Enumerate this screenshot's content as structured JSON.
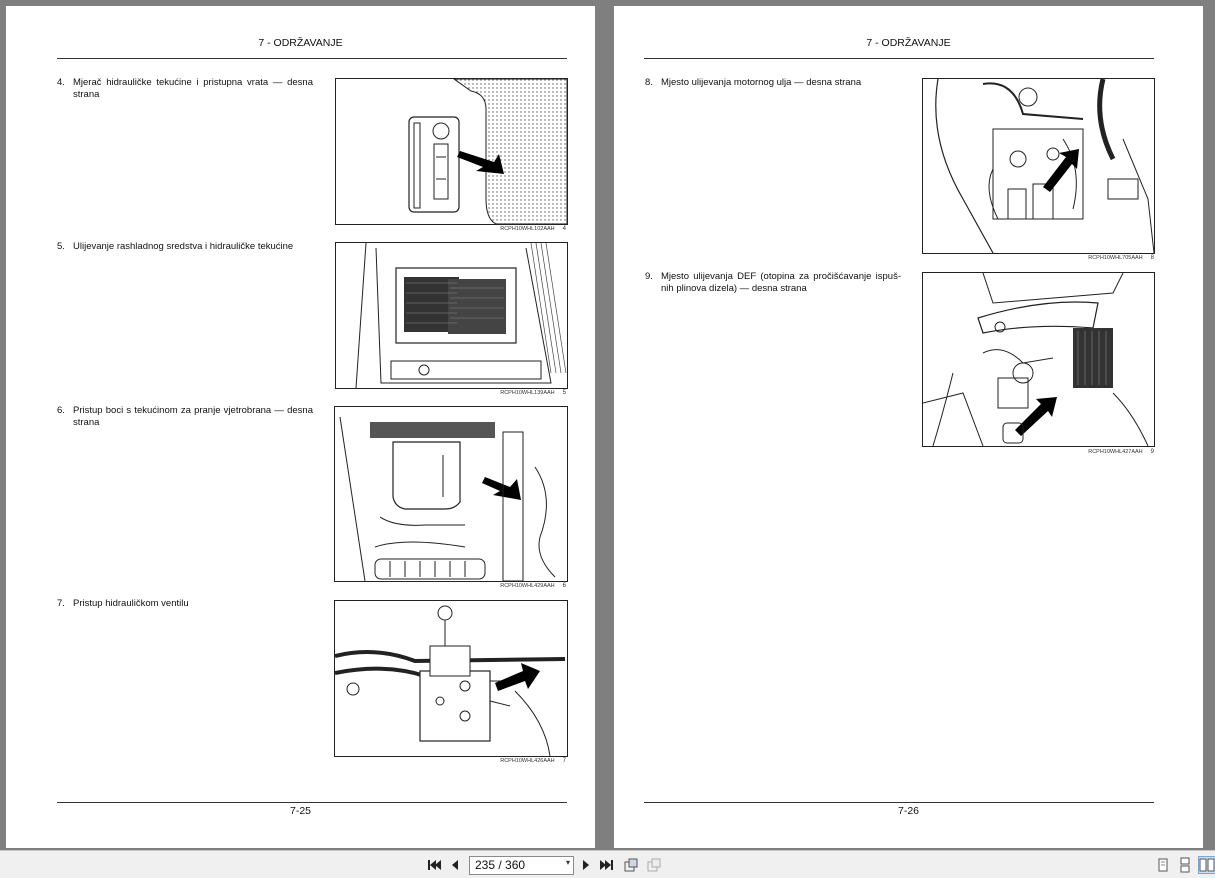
{
  "left_page": {
    "header": "7 - ODRŽAVANJE",
    "footer": "7-25",
    "items": [
      {
        "num": "4.",
        "text": "Mjerač hidrauličke tekućine i pristupna vrata — desna strana",
        "caption": "RCPH10WHL102AAH",
        "fig": "4"
      },
      {
        "num": "5.",
        "text": "Ulijevanje rashladnog sredstva i hidrauličke tekućine",
        "caption": "RCPH10WHL139AAH",
        "fig": "5"
      },
      {
        "num": "6.",
        "text": "Pristup boci s tekućinom za pranje vjetrobrana — desna strana",
        "caption": "RCPH10WHL429AAH",
        "fig": "6"
      },
      {
        "num": "7.",
        "text": "Pristup hidrauličkom ventilu",
        "caption": "RCPH10WHL426AAH",
        "fig": "7"
      }
    ]
  },
  "right_page": {
    "header": "7 - ODRŽAVANJE",
    "footer": "7-26",
    "items": [
      {
        "num": "8.",
        "text": "Mjesto ulijevanja motornog ulja — desna strana",
        "caption": "RCPH10WHL705AAH",
        "fig": "8"
      },
      {
        "num": "9.",
        "text": "Mjesto ulijevanja DEF (otopina za pročišćavanje ispuš-nih plinova dizela) — desna strana",
        "caption": "RCPH10WHL427AAH",
        "fig": "9"
      }
    ]
  },
  "toolbar": {
    "first_icon": "first-page-icon",
    "prev_icon": "previous-page-icon",
    "page_value": "235 / 360",
    "next_icon": "next-page-icon",
    "last_icon": "last-page-icon",
    "view_icons": [
      "single-page-view-icon",
      "continuous-view-icon",
      "two-page-view-icon"
    ]
  }
}
